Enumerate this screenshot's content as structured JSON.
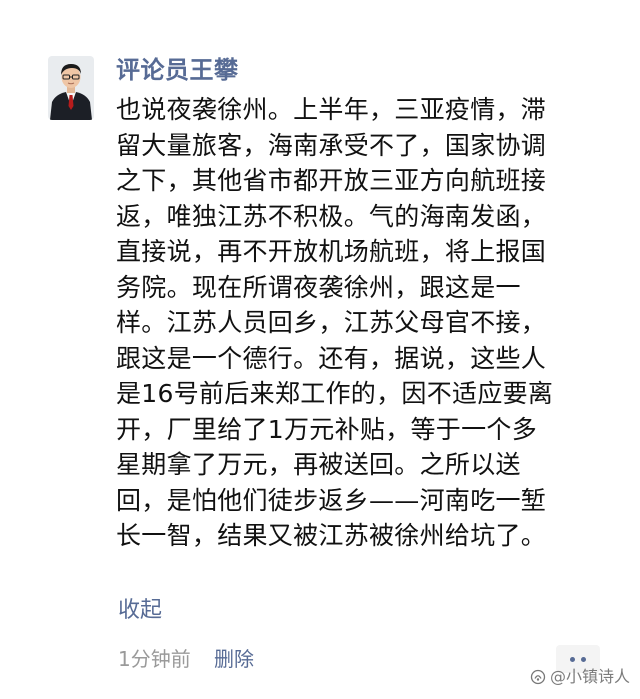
{
  "post": {
    "author": "评论员王攀",
    "lines": [
      "也说夜袭徐州。上半年，三亚疫情，滞",
      "留大量旅客，海南承受不了，国家协调",
      "之下，其他省市都开放三亚方向航班接",
      "返，唯独江苏不积极。气的海南发函，",
      "直接说，再不开放机场航班，将上报国",
      "务院。现在所谓夜袭徐州，跟这是一",
      "样。江苏人员回乡，江苏父母官不接，",
      "跟这是一个德行。还有，据说，这些人",
      "是16号前后来郑工作的，因不适应要离",
      "开，厂里给了1万元补贴，等于一个多",
      "星期拿了万元，再被送回。之所以送",
      "回，是怕他们徒步返乡——河南吃一堑",
      "长一智，结果又被江苏被徐州给坑了。"
    ],
    "collapse_label": "收起",
    "time_label": "1分钟前",
    "delete_label": "删除",
    "more_icon": "more-dots-icon"
  },
  "watermark": {
    "text": "@小镇诗人",
    "icon": "watermark-logo-icon"
  },
  "colors": {
    "link_blue": "#576b95",
    "text": "#111111",
    "meta_gray": "#9a9a9a"
  }
}
